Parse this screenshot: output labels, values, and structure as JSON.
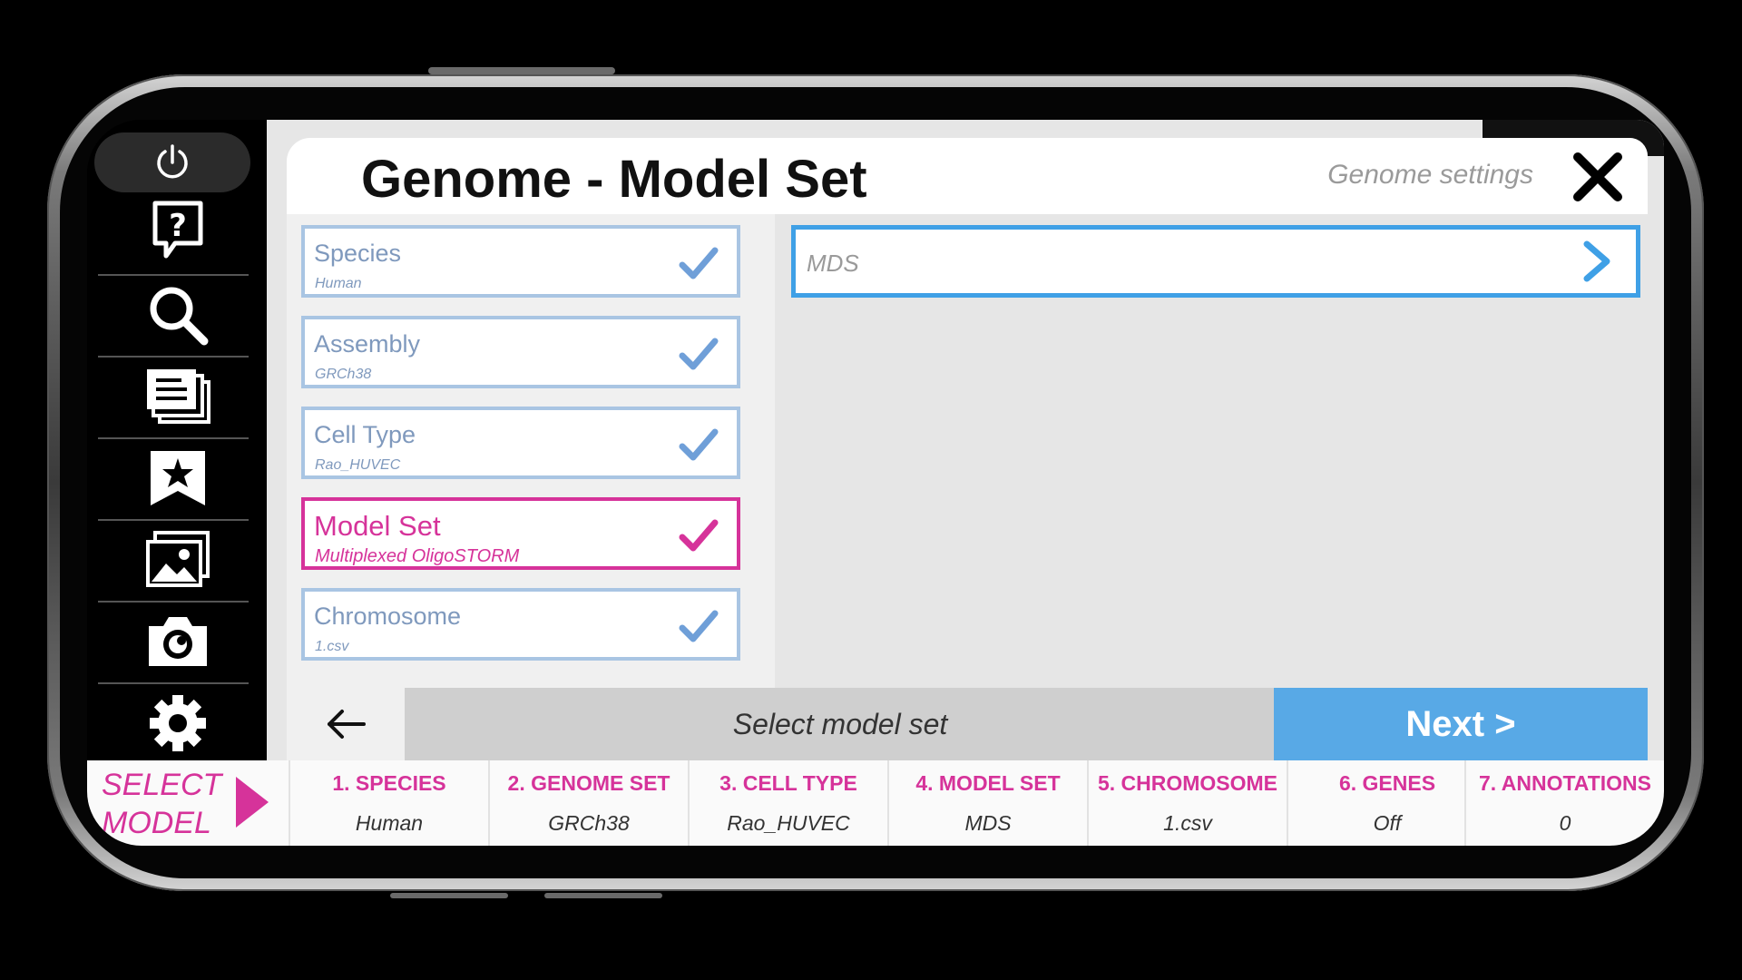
{
  "app": {
    "dialog_title": "Genome - Model Set",
    "dialog_subtitle": "Genome settings"
  },
  "toolbar": {
    "tools": [
      {
        "icon": "power-icon"
      },
      {
        "icon": "help-icon"
      },
      {
        "icon": "search-icon"
      },
      {
        "icon": "documents-icon"
      },
      {
        "icon": "bookmark-star-icon"
      },
      {
        "icon": "gallery-icon"
      },
      {
        "icon": "camera-icon"
      },
      {
        "icon": "settings-gear-icon"
      }
    ]
  },
  "steps": [
    {
      "label": "Species",
      "value": "Human",
      "state": "done"
    },
    {
      "label": "Assembly",
      "value": "GRCh38",
      "state": "done"
    },
    {
      "label": "Cell Type",
      "value": "Rao_HUVEC",
      "state": "done"
    },
    {
      "label": "Model Set",
      "value": "Multiplexed OligoSTORM",
      "state": "active"
    },
    {
      "label": "Chromosome",
      "value": "1.csv",
      "state": "done"
    }
  ],
  "options": [
    {
      "label": "MDS"
    }
  ],
  "footer": {
    "status": "Select model set",
    "next_label": "Next >"
  },
  "breadcrumb": {
    "select_line1": "SELECT",
    "select_line2": "MODEL",
    "items": [
      {
        "title": "1. SPECIES",
        "value": "Human"
      },
      {
        "title": "2. GENOME SET",
        "value": "GRCh38"
      },
      {
        "title": "3. CELL TYPE",
        "value": "Rao_HUVEC"
      },
      {
        "title": "4. MODEL SET",
        "value": "MDS"
      },
      {
        "title": "5. CHROMOSOME",
        "value": "1.csv"
      },
      {
        "title": "6. GENES",
        "value": "Off"
      },
      {
        "title": "7. ANNOTATIONS",
        "value": "0"
      }
    ]
  },
  "colors": {
    "accent_magenta": "#d6339a",
    "accent_blue": "#3fa0e6",
    "next_button": "#58a9e6",
    "step_done": "#7f99bd"
  }
}
